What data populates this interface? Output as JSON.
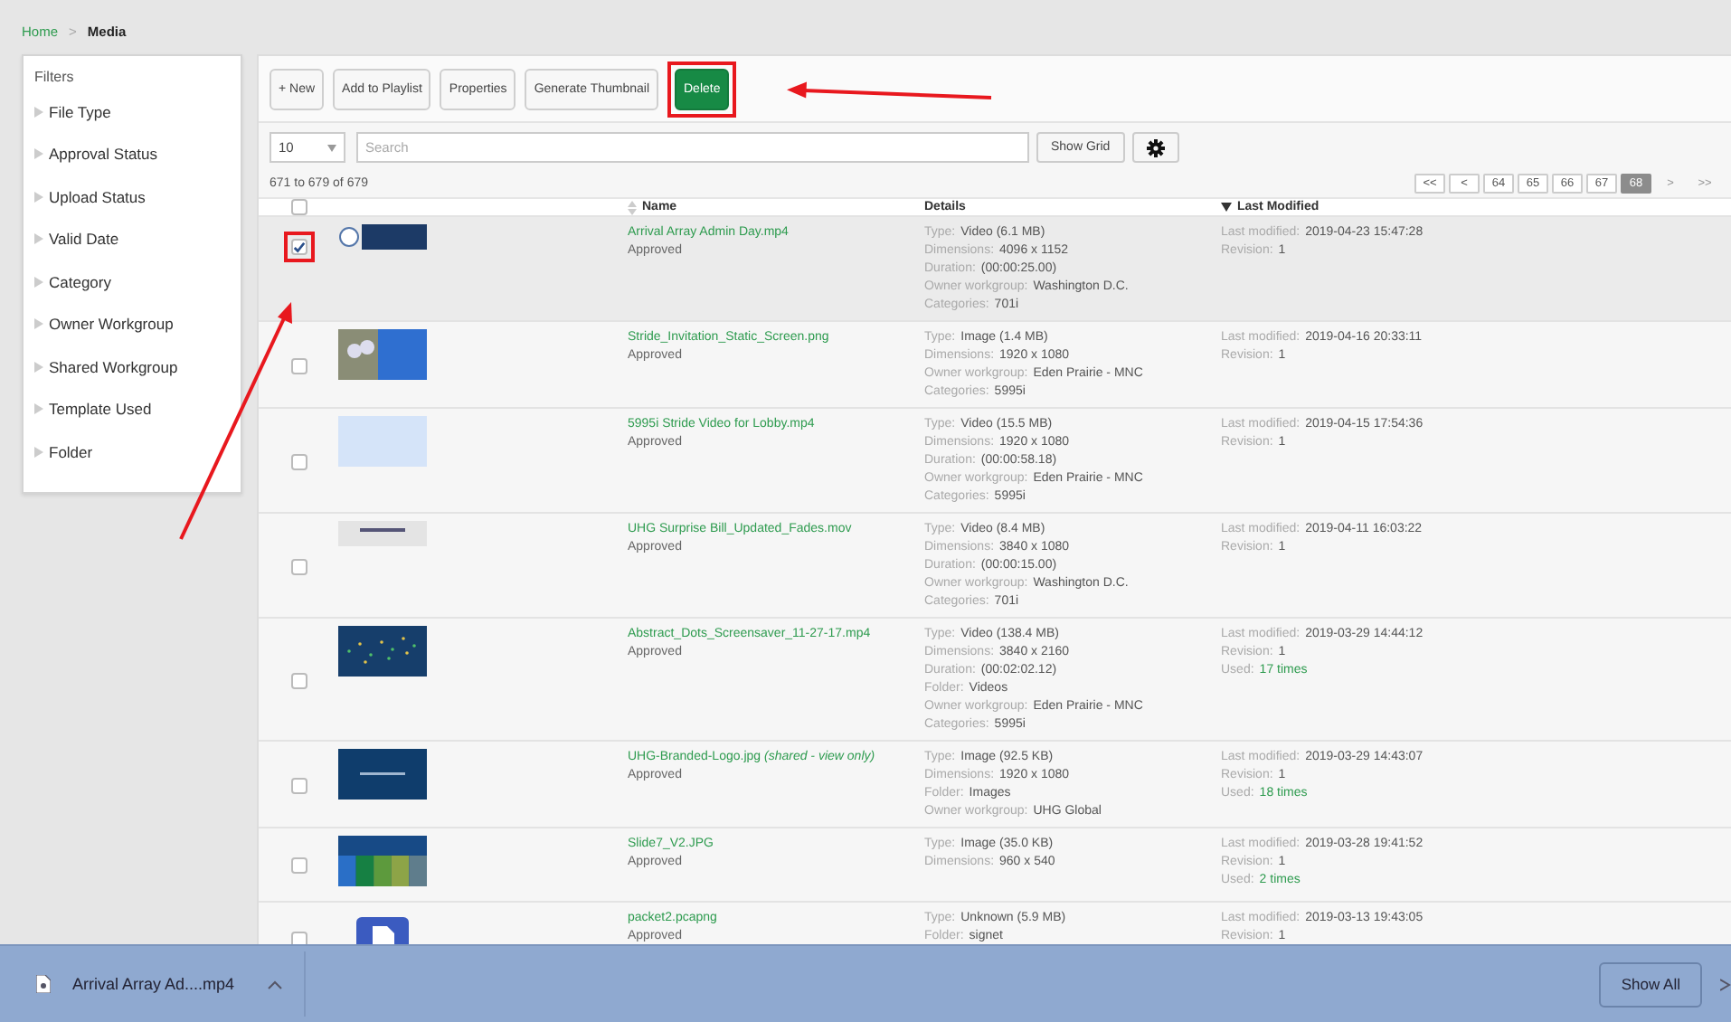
{
  "breadcrumb": {
    "items": [
      {
        "label": "Home",
        "kind": "link"
      },
      {
        "label": "Media",
        "kind": "current"
      }
    ],
    "separator": ">"
  },
  "filters": {
    "title": "Filters",
    "items": [
      {
        "label": "File Type",
        "expanded": false
      },
      {
        "label": "Approval Status",
        "expanded": false
      },
      {
        "label": "Upload Status",
        "expanded": false
      },
      {
        "label": "Valid Date",
        "expanded": false
      },
      {
        "label": "Category",
        "expanded": false
      },
      {
        "label": "Owner Workgroup",
        "expanded": false
      },
      {
        "label": "Shared Workgroup",
        "expanded": false
      },
      {
        "label": "Template Used",
        "expanded": false
      },
      {
        "label": "Folder",
        "expanded": false
      }
    ]
  },
  "toolbar": [
    {
      "label": "+ New",
      "kind": "default",
      "highlighted": false
    },
    {
      "label": "Add to Playlist",
      "kind": "default",
      "highlighted": false
    },
    {
      "label": "Properties",
      "kind": "default",
      "highlighted": false
    },
    {
      "label": "Generate Thumbnail",
      "kind": "default",
      "highlighted": false
    },
    {
      "label": "Delete",
      "kind": "danger",
      "highlighted": true
    }
  ],
  "list_controls": {
    "page_size": "10",
    "search": {
      "placeholder": "Search"
    },
    "show_grid": "Show Grid"
  },
  "range": "671 to 679 of 679",
  "pager": [
    {
      "label": "<<",
      "selected": false,
      "disabled": false
    },
    {
      "label": "<",
      "selected": false,
      "disabled": false
    },
    {
      "label": "64",
      "selected": false,
      "disabled": false
    },
    {
      "label": "65",
      "selected": false,
      "disabled": false
    },
    {
      "label": "66",
      "selected": false,
      "disabled": false
    },
    {
      "label": "67",
      "selected": false,
      "disabled": false
    },
    {
      "label": "68",
      "selected": true,
      "disabled": false
    },
    {
      "label": ">",
      "selected": false,
      "disabled": true
    },
    {
      "label": ">>",
      "selected": false,
      "disabled": true
    }
  ],
  "table": {
    "select_all_checked": false,
    "columns": [
      {
        "label": "Name",
        "kind": "sortable"
      },
      {
        "label": "Details",
        "kind": "plain"
      },
      {
        "label": "Last Modified",
        "kind": "sorted"
      }
    ],
    "rows": [
      {
        "checked": true,
        "highlighted": true,
        "kind": "slide",
        "name": "Arrival Array Admin Day.mp4",
        "status": "Approved",
        "details": [
          {
            "label": "Type:",
            "value": "Video (6.1 MB)"
          },
          {
            "label": "Dimensions:",
            "value": "4096 x 1152"
          },
          {
            "label": "Duration:",
            "value": "(00:00:25.00)"
          },
          {
            "label": "Owner workgroup:",
            "value": "Washington D.C."
          },
          {
            "label": "Categories:",
            "value": "701i"
          }
        ],
        "modified": [
          {
            "label": "Last modified:",
            "value": "2019-04-23 15:47:28",
            "kind": "text"
          },
          {
            "label": "Revision:",
            "value": "1",
            "kind": "text"
          }
        ]
      },
      {
        "checked": false,
        "highlighted": false,
        "kind": "photo",
        "name": "Stride_Invitation_Static_Screen.png",
        "status": "Approved",
        "details": [
          {
            "label": "Type:",
            "value": "Image (1.4 MB)"
          },
          {
            "label": "Dimensions:",
            "value": "1920 x 1080"
          },
          {
            "label": "Owner workgroup:",
            "value": "Eden Prairie - MNC"
          },
          {
            "label": "Categories:",
            "value": "5995i"
          }
        ],
        "modified": [
          {
            "label": "Last modified:",
            "value": "2019-04-16 20:33:11",
            "kind": "text"
          },
          {
            "label": "Revision:",
            "value": "1",
            "kind": "text"
          }
        ]
      },
      {
        "checked": false,
        "highlighted": false,
        "kind": "blank",
        "name": "5995i Stride Video for Lobby.mp4",
        "status": "Approved",
        "details": [
          {
            "label": "Type:",
            "value": "Video (15.5 MB)"
          },
          {
            "label": "Dimensions:",
            "value": "1920 x 1080"
          },
          {
            "label": "Duration:",
            "value": "(00:00:58.18)"
          },
          {
            "label": "Owner workgroup:",
            "value": "Eden Prairie - MNC"
          },
          {
            "label": "Categories:",
            "value": "5995i"
          }
        ],
        "modified": [
          {
            "label": "Last modified:",
            "value": "2019-04-15 17:54:36",
            "kind": "text"
          },
          {
            "label": "Revision:",
            "value": "1",
            "kind": "text"
          }
        ]
      },
      {
        "checked": false,
        "highlighted": false,
        "kind": "pale",
        "name": "UHG Surprise Bill_Updated_Fades.mov",
        "status": "Approved",
        "details": [
          {
            "label": "Type:",
            "value": "Video (8.4 MB)"
          },
          {
            "label": "Dimensions:",
            "value": "3840 x 1080"
          },
          {
            "label": "Duration:",
            "value": "(00:00:15.00)"
          },
          {
            "label": "Owner workgroup:",
            "value": "Washington D.C."
          },
          {
            "label": "Categories:",
            "value": "701i"
          }
        ],
        "modified": [
          {
            "label": "Last modified:",
            "value": "2019-04-11 16:03:22",
            "kind": "text"
          },
          {
            "label": "Revision:",
            "value": "1",
            "kind": "text"
          }
        ]
      },
      {
        "checked": false,
        "highlighted": false,
        "kind": "dots",
        "name": "Abstract_Dots_Screensaver_11-27-17.mp4",
        "status": "Approved",
        "details": [
          {
            "label": "Type:",
            "value": "Video (138.4 MB)"
          },
          {
            "label": "Dimensions:",
            "value": "3840 x 2160"
          },
          {
            "label": "Duration:",
            "value": "(00:02:02.12)"
          },
          {
            "label": "Folder:",
            "value": "Videos"
          },
          {
            "label": "Owner workgroup:",
            "value": "Eden Prairie - MNC"
          },
          {
            "label": "Categories:",
            "value": "5995i"
          }
        ],
        "modified": [
          {
            "label": "Last modified:",
            "value": "2019-03-29 14:44:12",
            "kind": "text"
          },
          {
            "label": "Revision:",
            "value": "1",
            "kind": "text"
          },
          {
            "label": "Used:",
            "value": "17 times",
            "kind": "link"
          }
        ]
      },
      {
        "checked": false,
        "highlighted": false,
        "kind": "banner",
        "name": "UHG-Branded-Logo.jpg *(shared - view only)*",
        "status": "Approved",
        "details": [
          {
            "label": "Type:",
            "value": "Image (92.5 KB)"
          },
          {
            "label": "Dimensions:",
            "value": "1920 x 1080"
          },
          {
            "label": "Folder:",
            "value": "Images"
          },
          {
            "label": "Owner workgroup:",
            "value": "UHG Global"
          }
        ],
        "modified": [
          {
            "label": "Last modified:",
            "value": "2019-03-29 14:43:07",
            "kind": "text"
          },
          {
            "label": "Revision:",
            "value": "1",
            "kind": "text"
          },
          {
            "label": "Used:",
            "value": "18 times",
            "kind": "link"
          }
        ]
      },
      {
        "checked": false,
        "highlighted": false,
        "kind": "columns",
        "name": "Slide7_V2.JPG",
        "status": "Approved",
        "details": [
          {
            "label": "Type:",
            "value": "Image (35.0 KB)"
          },
          {
            "label": "Dimensions:",
            "value": "960 x 540"
          }
        ],
        "modified": [
          {
            "label": "Last modified:",
            "value": "2019-03-28 19:41:52",
            "kind": "text"
          },
          {
            "label": "Revision:",
            "value": "1",
            "kind": "text"
          },
          {
            "label": "Used:",
            "value": "2 times",
            "kind": "link"
          }
        ]
      },
      {
        "checked": false,
        "highlighted": false,
        "kind": "file",
        "name": "packet2.pcapng",
        "status": "Approved",
        "details": [
          {
            "label": "Type:",
            "value": "Unknown (5.9 MB)"
          },
          {
            "label": "Folder:",
            "value": "signet"
          }
        ],
        "modified": [
          {
            "label": "Last modified:",
            "value": "2019-03-13 19:43:05",
            "kind": "text"
          },
          {
            "label": "Revision:",
            "value": "1",
            "kind": "text"
          }
        ]
      }
    ]
  },
  "download_bar": {
    "file": "Arrival Array Ad....mp4",
    "button": "Show All"
  }
}
